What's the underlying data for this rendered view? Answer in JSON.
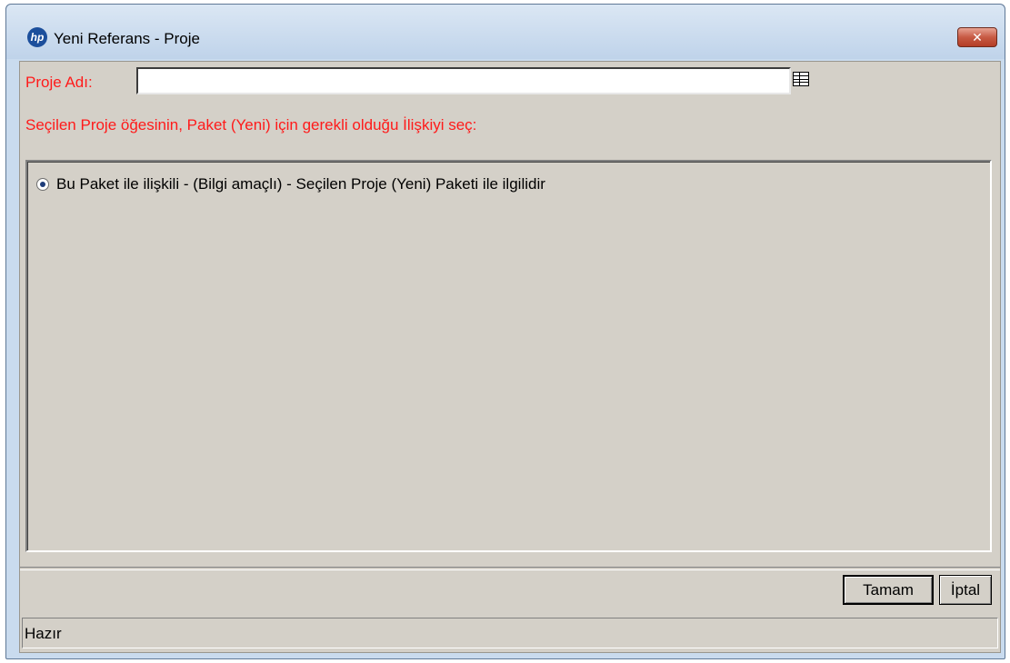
{
  "window": {
    "title": "Yeni Referans - Proje",
    "app_icon": "hp-logo",
    "close_glyph": "✕"
  },
  "form": {
    "field_label": "Proje Adı:",
    "name_value": "",
    "name_placeholder": "",
    "lookup_icon": "list-lookup-icon",
    "relation_prompt": "Seçilen Proje öğesinin, Paket (Yeni) için gerekli olduğu İlişkiyi seç:",
    "relation_options": [
      {
        "label": "Bu Paket ile ilişkili - (Bilgi amaçlı) - Seçilen Proje (Yeni) Paketi ile ilgilidir",
        "selected": true
      }
    ]
  },
  "buttons": {
    "ok_label": "Tamam",
    "cancel_label": "İptal"
  },
  "status": {
    "text": "Hazır"
  },
  "colors": {
    "required_label": "#ff1a1a",
    "dialog_background": "#d4d0c8",
    "title_bar": "#c9dbee",
    "close_button": "#c75a44"
  }
}
